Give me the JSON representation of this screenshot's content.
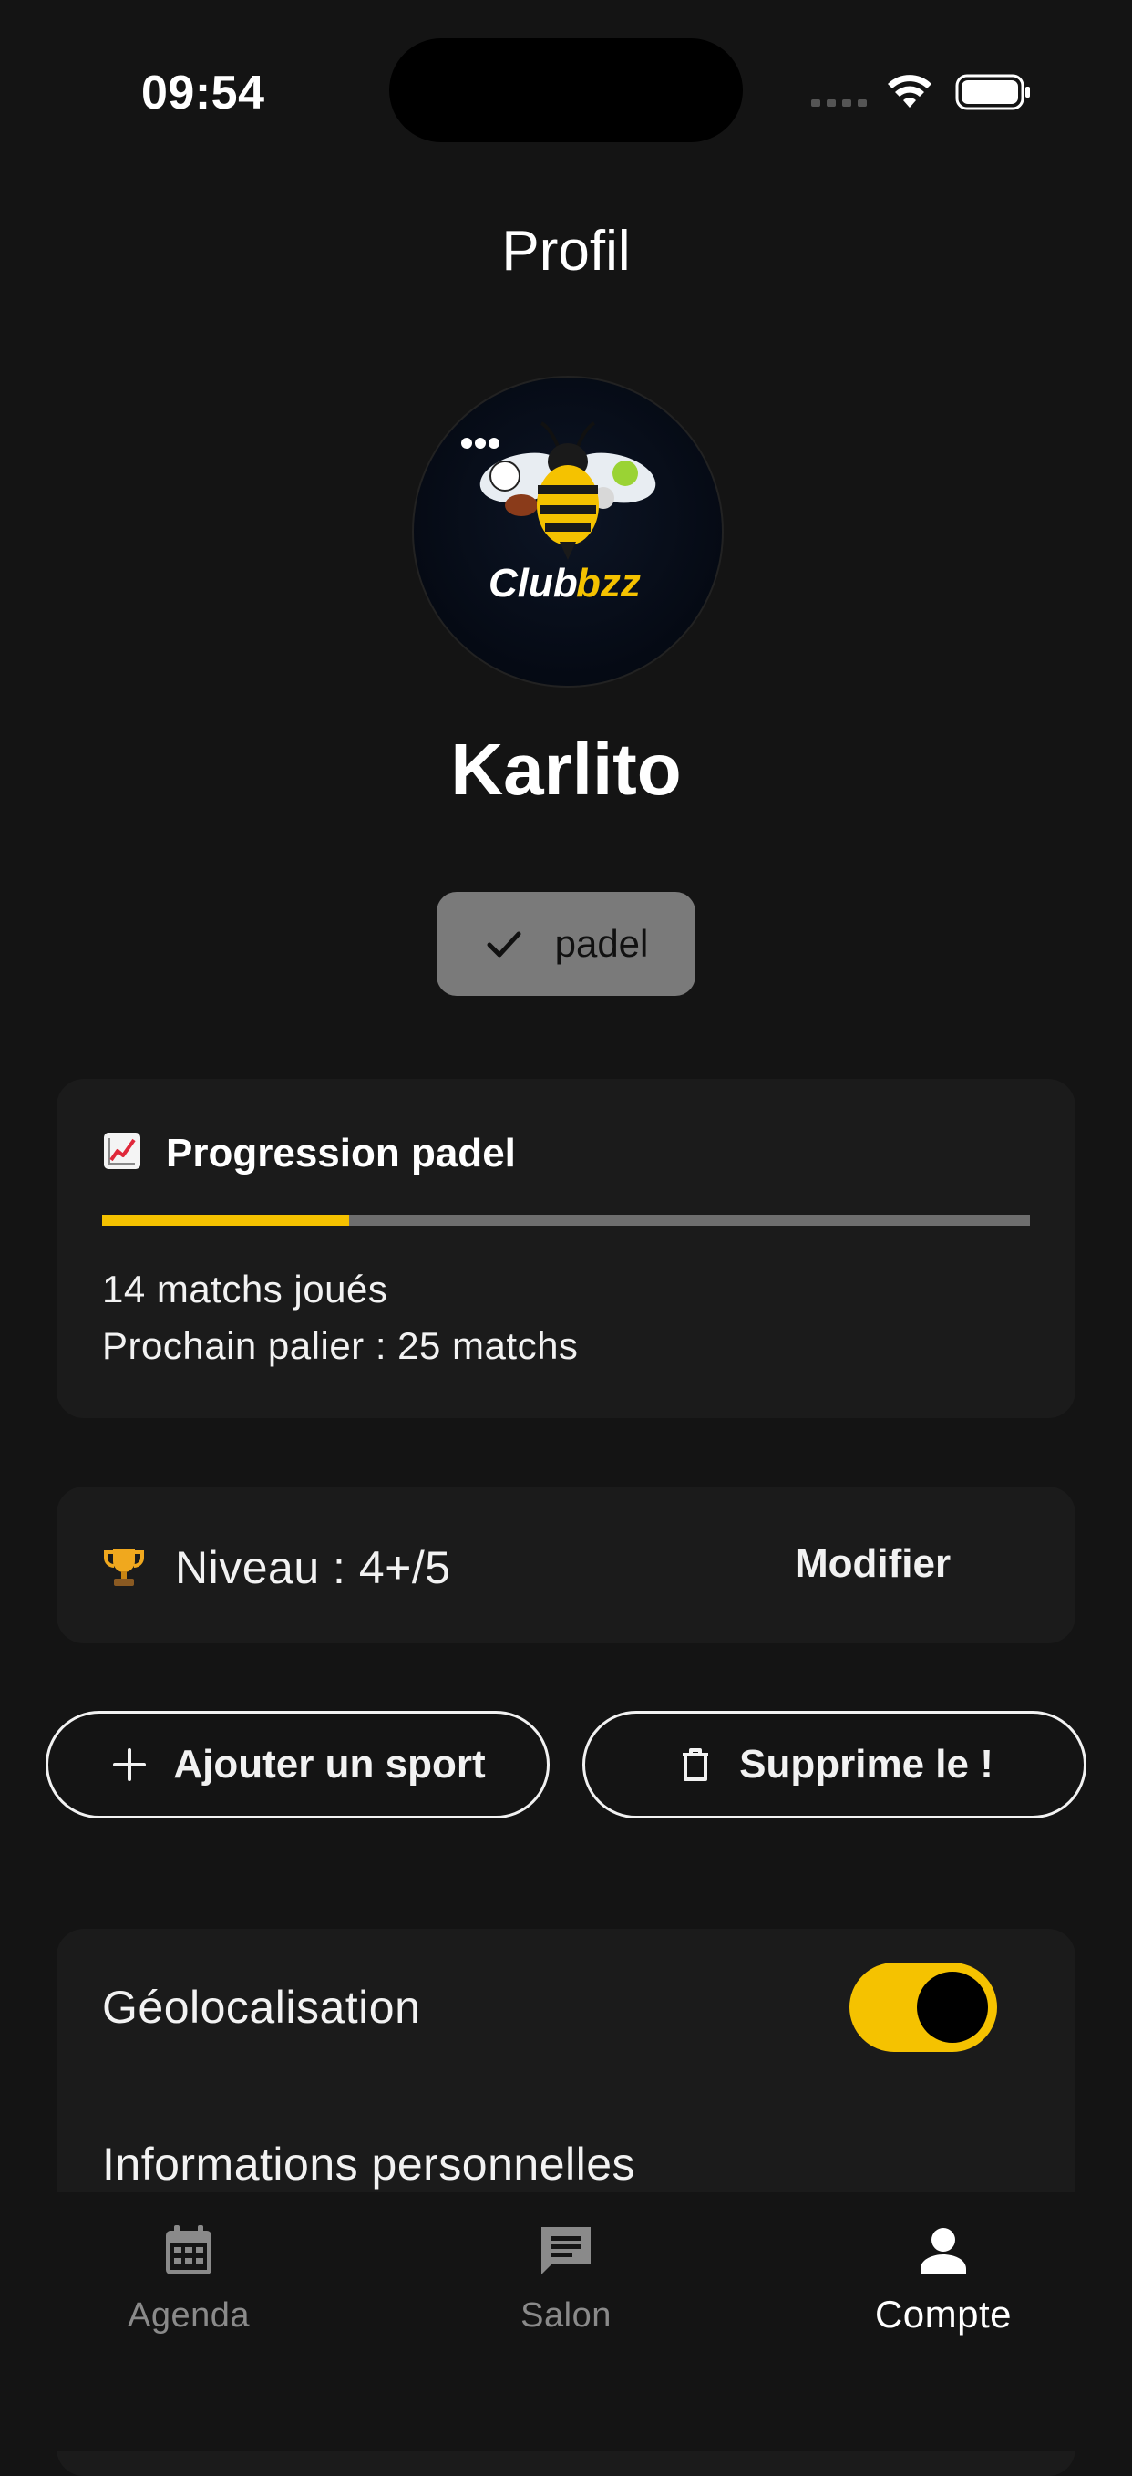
{
  "status_bar": {
    "time": "09:54"
  },
  "header": {
    "title": "Profil"
  },
  "profile": {
    "avatar_brand": {
      "text_main": "Club",
      "text_accent": "bzz"
    },
    "name": "Karlito",
    "sport_chip": {
      "label": "padel",
      "selected": true
    }
  },
  "progress": {
    "title": "Progression padel",
    "matches_played_text": "14 matchs joués",
    "next_tier_text": "Prochain palier : 25 matchs",
    "matches_played": 14,
    "next_tier": 25,
    "fill_fraction": 0.266,
    "accent_color": "#f5c200"
  },
  "level": {
    "text": "Niveau : 4+/5",
    "modify_label": "Modifier"
  },
  "actions": {
    "add_sport_label": "Ajouter un sport",
    "delete_label": "Supprime le !"
  },
  "settings": {
    "geolocation_label": "Géolocalisation",
    "geolocation_enabled": true,
    "personal_info_label": "Informations personnelles"
  },
  "tabs": [
    {
      "label": "Agenda",
      "icon": "calendar-icon",
      "active": false
    },
    {
      "label": "Salon",
      "icon": "chat-icon",
      "active": false
    },
    {
      "label": "Compte",
      "icon": "person-icon",
      "active": true
    }
  ]
}
